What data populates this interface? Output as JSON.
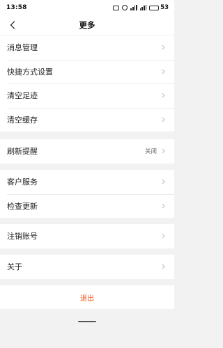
{
  "status_bar": {
    "time": "13:58",
    "icons": [
      "nfc-icon",
      "alarm-icon",
      "signal-icon",
      "signal-icon",
      "battery-icon"
    ],
    "battery": "53"
  },
  "nav": {
    "back_icon": "chevron-left-icon",
    "title": "更多"
  },
  "groups": [
    {
      "items": [
        {
          "label": "消息管理"
        },
        {
          "label": "快捷方式设置"
        },
        {
          "label": "清空足迹"
        },
        {
          "label": "清空缓存"
        }
      ]
    },
    {
      "items": [
        {
          "label": "刷新提醒",
          "value": "关闭"
        }
      ]
    },
    {
      "items": [
        {
          "label": "客户服务"
        },
        {
          "label": "检查更新"
        }
      ]
    },
    {
      "items": [
        {
          "label": "注销账号"
        }
      ]
    },
    {
      "items": [
        {
          "label": "关于"
        }
      ]
    }
  ],
  "logout": {
    "label": "退出"
  },
  "colors": {
    "accent": "#e8581d",
    "background": "#f2f2f2",
    "card": "#ffffff",
    "chevron": "#bbbbbb"
  }
}
